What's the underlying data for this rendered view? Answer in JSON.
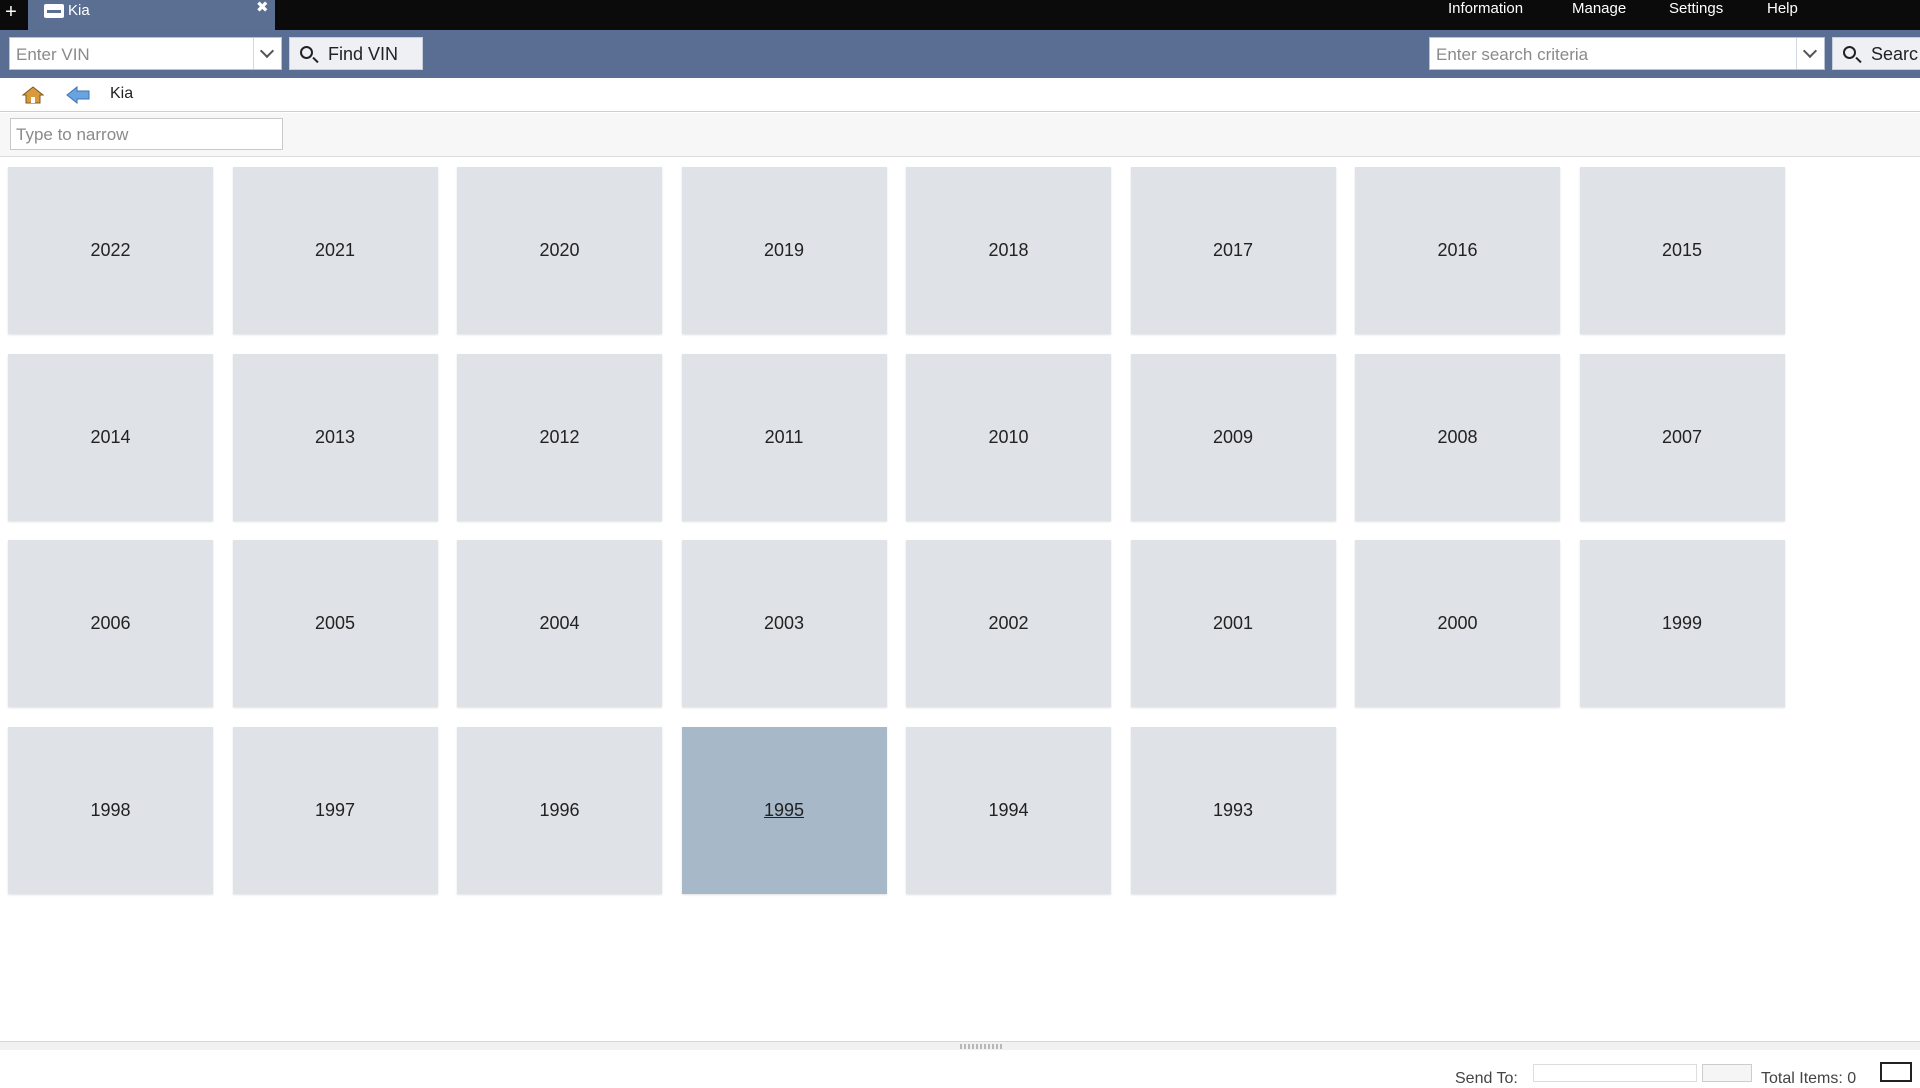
{
  "tabbar": {
    "new_tab_glyph": "+",
    "active_tab": {
      "label": "Kia",
      "close_glyph": "✖"
    },
    "menu": [
      "Information",
      "Manage",
      "Settings",
      "Help"
    ]
  },
  "toolbar": {
    "vin_placeholder": "Enter VIN",
    "find_vin_label": "Find VIN",
    "search_placeholder": "Enter search criteria",
    "search_label": "Searc"
  },
  "breadcrumb": {
    "current": "Kia"
  },
  "filter": {
    "placeholder": "Type to narrow"
  },
  "years": [
    "2022",
    "2021",
    "2020",
    "2019",
    "2018",
    "2017",
    "2016",
    "2015",
    "2014",
    "2013",
    "2012",
    "2011",
    "2010",
    "2009",
    "2008",
    "2007",
    "2006",
    "2005",
    "2004",
    "2003",
    "2002",
    "2001",
    "2000",
    "1999",
    "1998",
    "1997",
    "1996",
    "1995",
    "1994",
    "1993"
  ],
  "selected_year": "1995",
  "statusbar": {
    "send_to_label": "Send To:",
    "total_items_label": "Total Items: 0"
  },
  "colors": {
    "toolbar": "#5a6d93",
    "tile": "#dfe3e8",
    "tile_selected": "#a7b8c8"
  }
}
